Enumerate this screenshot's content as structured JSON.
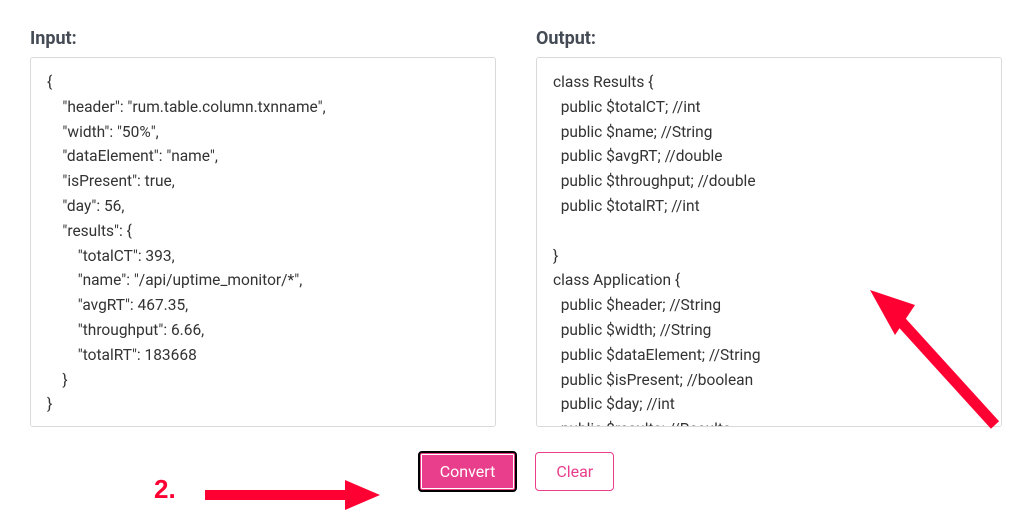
{
  "input": {
    "label": "Input:",
    "content": "{\n    \"header\": \"rum.table.column.txnname\",\n    \"width\": \"50%\",\n    \"dataElement\": \"name\",\n    \"isPresent\": true,\n    \"day\": 56,\n    \"results\": {\n        \"totalCT\": 393,\n        \"name\": \"/api/uptime_monitor/*\",\n        \"avgRT\": 467.35,\n        \"throughput\": 6.66,\n        \"totalRT\": 183668\n    }\n}"
  },
  "output": {
    "label": "Output:",
    "content": "class Results {\n  public $totalCT; //int\n  public $name; //String\n  public $avgRT; //double\n  public $throughput; //double\n  public $totalRT; //int\n\n}\nclass Application {\n  public $header; //String\n  public $width; //String\n  public $dataElement; //String\n  public $isPresent; //boolean\n  public $day; //int\n  public $results; //Results\n\n}"
  },
  "buttons": {
    "convert": "Convert",
    "clear": "Clear"
  },
  "annotation": {
    "step2": "2."
  }
}
